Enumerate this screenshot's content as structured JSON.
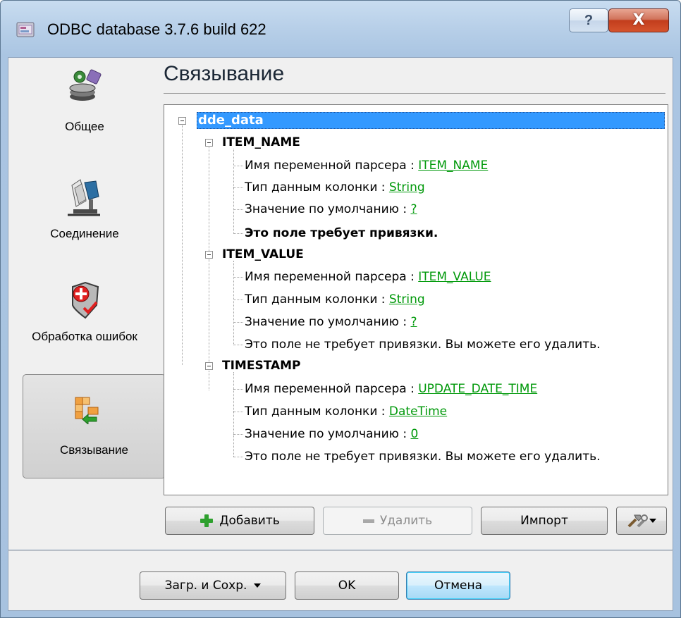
{
  "window": {
    "title": "ODBC database 3.7.6 build 622",
    "help_label": "?",
    "close_label": "X"
  },
  "sidebar": {
    "items": [
      {
        "label": "Общее",
        "icon": "general-settings-icon"
      },
      {
        "label": "Соединение",
        "icon": "connection-icon"
      },
      {
        "label": "Обработка ошибок",
        "icon": "error-handling-icon"
      },
      {
        "label": "Связывание",
        "icon": "binding-icon",
        "selected": true
      }
    ]
  },
  "page": {
    "title": "Связывание"
  },
  "tree": {
    "root": "dde_data",
    "fields": [
      {
        "name": "ITEM_NAME",
        "var_label": "Имя переменной парсера : ",
        "var_value": "ITEM_NAME",
        "type_label": "Тип данным колонки : ",
        "type_value": "String",
        "default_label": "Значение по умолчанию : ",
        "default_value": "?",
        "note": "Это поле требует привязки."
      },
      {
        "name": "ITEM_VALUE",
        "var_label": "Имя переменной парсера : ",
        "var_value": "ITEM_VALUE",
        "type_label": "Тип данным колонки : ",
        "type_value": "String",
        "default_label": "Значение по умолчанию : ",
        "default_value": "?",
        "note": "Это поле не требует привязки. Вы можете его удалить."
      },
      {
        "name": "TIMESTAMP",
        "var_label": "Имя переменной парсера : ",
        "var_value": "UPDATE_DATE_TIME",
        "type_label": "Тип данным колонки : ",
        "type_value": "DateTime",
        "default_label": "Значение по умолчанию : ",
        "default_value": "0",
        "note": "Это поле не требует привязки. Вы можете его удалить."
      }
    ]
  },
  "actions": {
    "add": "Добавить",
    "delete": "Удалить",
    "import": "Импорт"
  },
  "footer": {
    "load_save": "Загр. и Сохр.",
    "ok": "OK",
    "cancel": "Отмена"
  },
  "colors": {
    "selection": "#3399ff",
    "link": "#00990a",
    "close_button": "#c23d1c"
  }
}
